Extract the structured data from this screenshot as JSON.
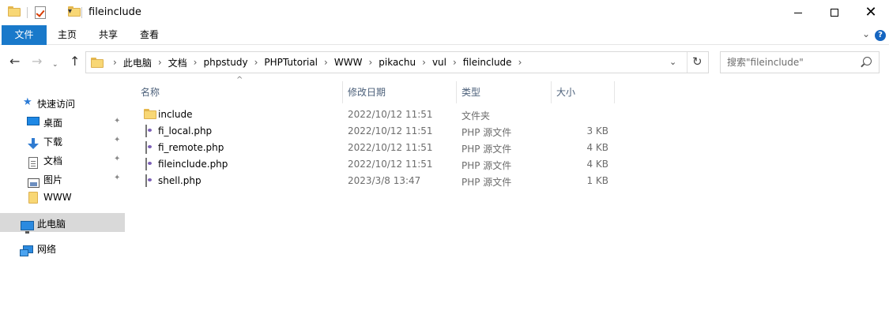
{
  "window": {
    "title": "fileinclude",
    "controls": {
      "minimize_icon": "minimize-icon",
      "maximize_icon": "maximize-icon",
      "close_icon": "close-icon",
      "close_glyph": "✕"
    }
  },
  "ribbon": {
    "tabs": [
      {
        "label": "文件",
        "active": true
      },
      {
        "label": "主页"
      },
      {
        "label": "共享"
      },
      {
        "label": "查看"
      }
    ],
    "help_glyph": "?"
  },
  "nav": {
    "breadcrumbs": [
      "此电脑",
      "文档",
      "phpstudy",
      "PHPTutorial",
      "WWW",
      "pikachu",
      "vul",
      "fileinclude"
    ],
    "search_placeholder": "搜索\"fileinclude\""
  },
  "sidebar": {
    "items": [
      {
        "label": "快速访问",
        "icon": "star-icon"
      },
      {
        "label": "桌面",
        "icon": "desktop-icon",
        "pinned": true
      },
      {
        "label": "下载",
        "icon": "download-icon",
        "pinned": true
      },
      {
        "label": "文档",
        "icon": "documents-icon",
        "pinned": true
      },
      {
        "label": "图片",
        "icon": "pictures-icon",
        "pinned": true
      },
      {
        "label": "WWW",
        "icon": "folder-icon"
      },
      {
        "label": "此电脑",
        "icon": "this-pc-icon",
        "selected": true
      },
      {
        "label": "网络",
        "icon": "network-icon"
      }
    ]
  },
  "filelist": {
    "columns": [
      "名称",
      "修改日期",
      "类型",
      "大小"
    ],
    "rows": [
      {
        "name": "include",
        "date": "2022/10/12 11:51",
        "type": "文件夹",
        "size": "",
        "icon": "folder-icon"
      },
      {
        "name": "fi_local.php",
        "date": "2022/10/12 11:51",
        "type": "PHP 源文件",
        "size": "3 KB",
        "icon": "php-file-icon"
      },
      {
        "name": "fi_remote.php",
        "date": "2022/10/12 11:51",
        "type": "PHP 源文件",
        "size": "4 KB",
        "icon": "php-file-icon"
      },
      {
        "name": "fileinclude.php",
        "date": "2022/10/12 11:51",
        "type": "PHP 源文件",
        "size": "4 KB",
        "icon": "php-file-icon"
      },
      {
        "name": "shell.php",
        "date": "2023/3/8 13:47",
        "type": "PHP 源文件",
        "size": "1 KB",
        "icon": "php-file-icon"
      }
    ]
  },
  "colors": {
    "accent": "#1979ca",
    "header_text": "#4c607a",
    "selection": "#d9d9d9",
    "folder": "#f8d775"
  }
}
